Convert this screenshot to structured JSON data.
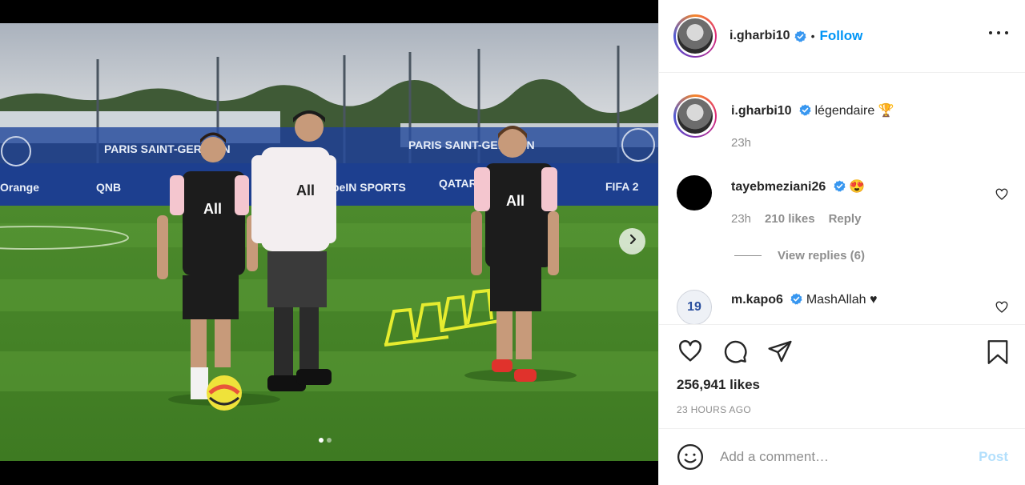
{
  "post": {
    "username": "i.gharbi10",
    "follow_label": "Follow",
    "separator": "•",
    "likes_text": "256,941 likes",
    "time_ago": "23 HOURS AGO",
    "carousel_count": 2,
    "carousel_active": 0
  },
  "caption": {
    "username": "i.gharbi10",
    "text": "légendaire 🏆",
    "time": "23h"
  },
  "comments": [
    {
      "username": "tayebmeziani26",
      "text": "😍",
      "time": "23h",
      "likes": "210 likes",
      "reply_label": "Reply",
      "view_replies": "View replies (6)"
    },
    {
      "username": "m.kapo6",
      "text": "MashAllah ♥",
      "avatar_text": "19"
    }
  ],
  "add_comment": {
    "placeholder": "Add a comment…",
    "post_label": "Post"
  },
  "icons": {
    "verified": "verified-badge-icon",
    "like": "heart-icon",
    "comment": "comment-icon",
    "share": "paper-plane-icon",
    "save": "bookmark-icon",
    "emoji": "emoji-icon",
    "more": "more-options-icon",
    "next": "chevron-right-icon"
  },
  "colors": {
    "link_blue": "#0095f6",
    "verified_blue": "#3897f0",
    "post_disabled": "#b2dffc",
    "muted": "#8e8e8e"
  }
}
